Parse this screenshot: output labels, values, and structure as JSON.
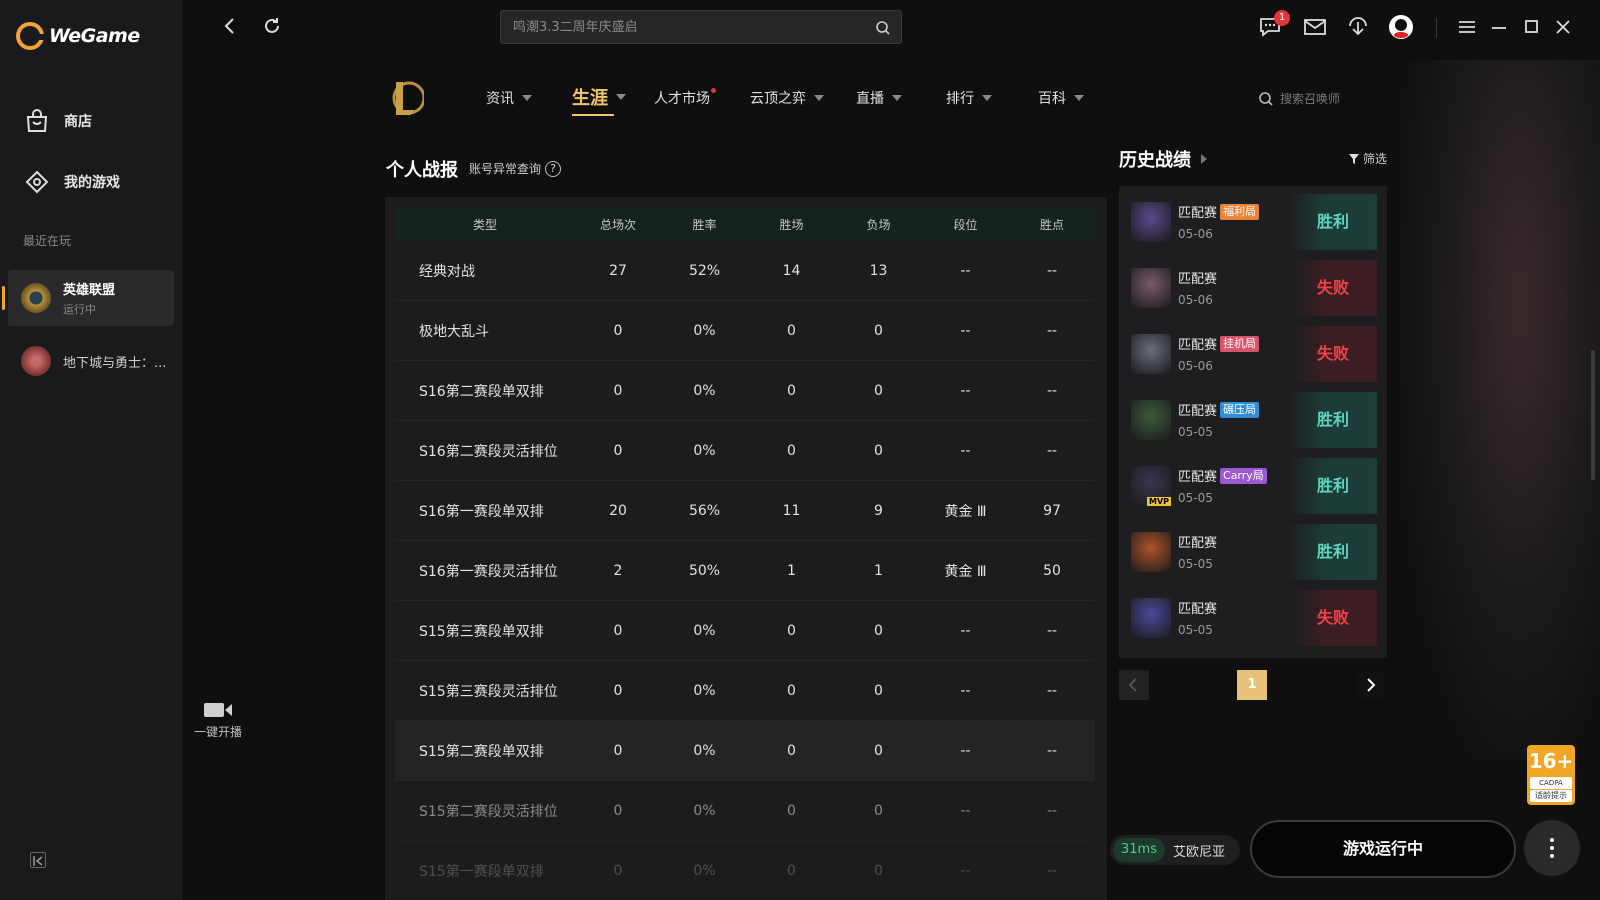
{
  "app": {
    "name": "WeGame"
  },
  "sidebar": {
    "items": [
      {
        "label": "商店",
        "icon": "store-bag-icon"
      },
      {
        "label": "我的游戏",
        "icon": "controller-icon"
      }
    ],
    "recent_label": "最近在玩",
    "recent": [
      {
        "name": "英雄联盟",
        "status": "运行中"
      },
      {
        "name": "地下城与勇士：...",
        "status": ""
      }
    ],
    "stream_label": "一键开播"
  },
  "topbar": {
    "search_placeholder": "鸣潮3.3二周年庆盛启",
    "notif_badge": "1"
  },
  "game_nav": {
    "tabs": [
      {
        "label": "资讯"
      },
      {
        "label": "生涯"
      },
      {
        "label": "人才市场"
      },
      {
        "label": "云顶之弈"
      },
      {
        "label": "直播"
      },
      {
        "label": "排行"
      },
      {
        "label": "百科"
      }
    ],
    "summoner_search_placeholder": "搜索召唤师"
  },
  "stats": {
    "title": "个人战报",
    "account_query": "账号异常查询",
    "headers": [
      "类型",
      "总场次",
      "胜率",
      "胜场",
      "负场",
      "段位",
      "胜点"
    ],
    "rows": [
      [
        "经典对战",
        "27",
        "52%",
        "14",
        "13",
        "--",
        "--"
      ],
      [
        "极地大乱斗",
        "0",
        "0%",
        "0",
        "0",
        "--",
        "--"
      ],
      [
        "S16第二赛段单双排",
        "0",
        "0%",
        "0",
        "0",
        "--",
        "--"
      ],
      [
        "S16第二赛段灵活排位",
        "0",
        "0%",
        "0",
        "0",
        "--",
        "--"
      ],
      [
        "S16第一赛段单双排",
        "20",
        "56%",
        "11",
        "9",
        "黄金 Ⅲ",
        "97"
      ],
      [
        "S16第一赛段灵活排位",
        "2",
        "50%",
        "1",
        "1",
        "黄金 Ⅲ",
        "50"
      ],
      [
        "S15第三赛段单双排",
        "0",
        "0%",
        "0",
        "0",
        "--",
        "--"
      ],
      [
        "S15第三赛段灵活排位",
        "0",
        "0%",
        "0",
        "0",
        "--",
        "--"
      ],
      [
        "S15第二赛段单双排",
        "0",
        "0%",
        "0",
        "0",
        "--",
        "--"
      ],
      [
        "S15第二赛段灵活排位",
        "0",
        "0%",
        "0",
        "0",
        "--",
        "--"
      ],
      [
        "S15第一赛段单双排",
        "0",
        "0%",
        "0",
        "0",
        "--",
        "--"
      ]
    ]
  },
  "history": {
    "title": "历史战绩",
    "filter_label": "筛选",
    "matches": [
      {
        "mode": "匹配赛",
        "tag": "福利局",
        "tag_color": "#e8833a",
        "date": "05-06",
        "result": "胜利",
        "win": true,
        "avatar_color": "#5a4a8a"
      },
      {
        "mode": "匹配赛",
        "tag": "",
        "tag_color": "",
        "date": "05-06",
        "result": "失败",
        "win": false,
        "avatar_color": "#7a5a6a"
      },
      {
        "mode": "匹配赛",
        "tag": "挂机局",
        "tag_color": "#d9536a",
        "date": "05-06",
        "result": "失败",
        "win": false,
        "avatar_color": "#6a6f7a"
      },
      {
        "mode": "匹配赛",
        "tag": "碾压局",
        "tag_color": "#2e8fd8",
        "date": "05-05",
        "result": "胜利",
        "win": true,
        "avatar_color": "#3f5a3a"
      },
      {
        "mode": "匹配赛",
        "tag": "Carry局",
        "tag_color": "#9b59d0",
        "date": "05-05",
        "result": "胜利",
        "win": true,
        "avatar_color": "#3a3550",
        "mvp": "MVP"
      },
      {
        "mode": "匹配赛",
        "tag": "",
        "tag_color": "",
        "date": "05-05",
        "result": "胜利",
        "win": true,
        "avatar_color": "#b0552a"
      },
      {
        "mode": "匹配赛",
        "tag": "",
        "tag_color": "",
        "date": "05-05",
        "result": "失败",
        "win": false,
        "avatar_color": "#4a4a9a"
      }
    ],
    "page": "1"
  },
  "footer": {
    "ping": "31ms",
    "server": "艾欧尼亚",
    "launch_label": "游戏运行中",
    "age_rating": "16+",
    "age_text": "适龄提示",
    "age_brand": "CADPA"
  }
}
